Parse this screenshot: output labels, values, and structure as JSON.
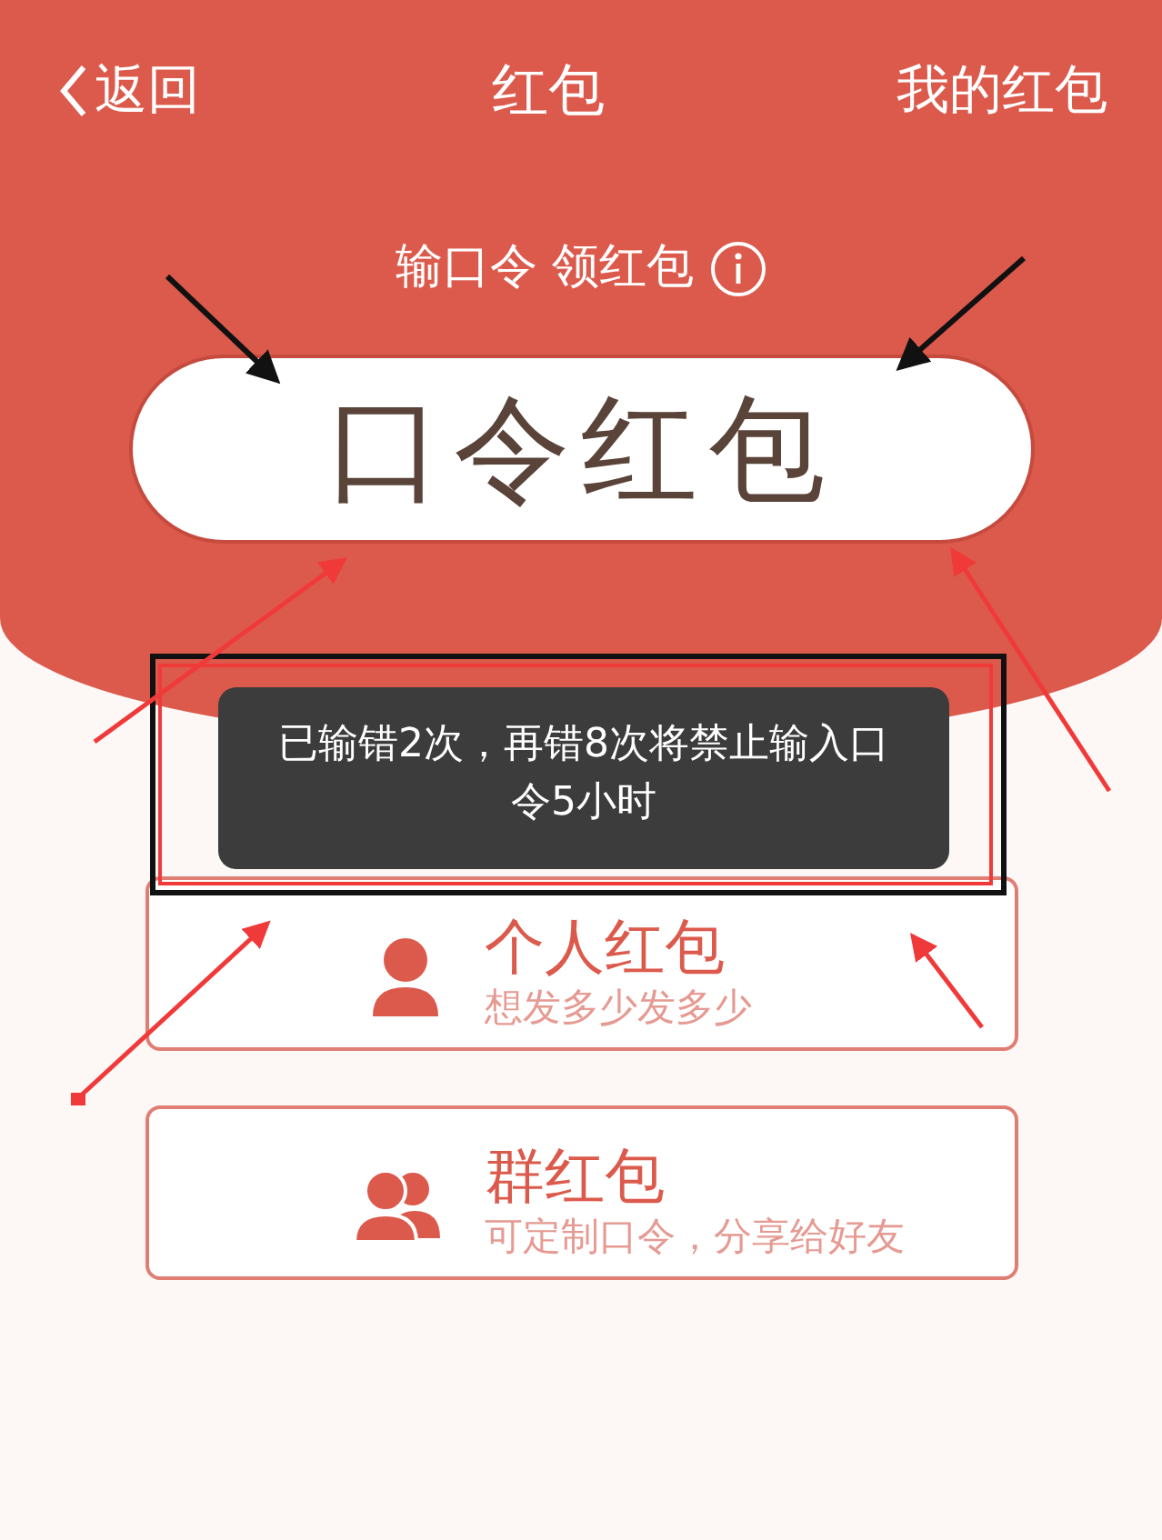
{
  "nav": {
    "back": "返回",
    "title": "红包",
    "right": "我的红包"
  },
  "prompt": {
    "label": "输口令 领红包"
  },
  "code_field": {
    "value": "口令红包"
  },
  "toast": {
    "text": "已输错2次，再错8次将禁止输入口令5小时"
  },
  "options": [
    {
      "kind": "single",
      "title": "个人红包",
      "subtitle": "想发多少发多少"
    },
    {
      "kind": "group",
      "title": "群红包",
      "subtitle": "可定制口令，分享给好友"
    }
  ]
}
